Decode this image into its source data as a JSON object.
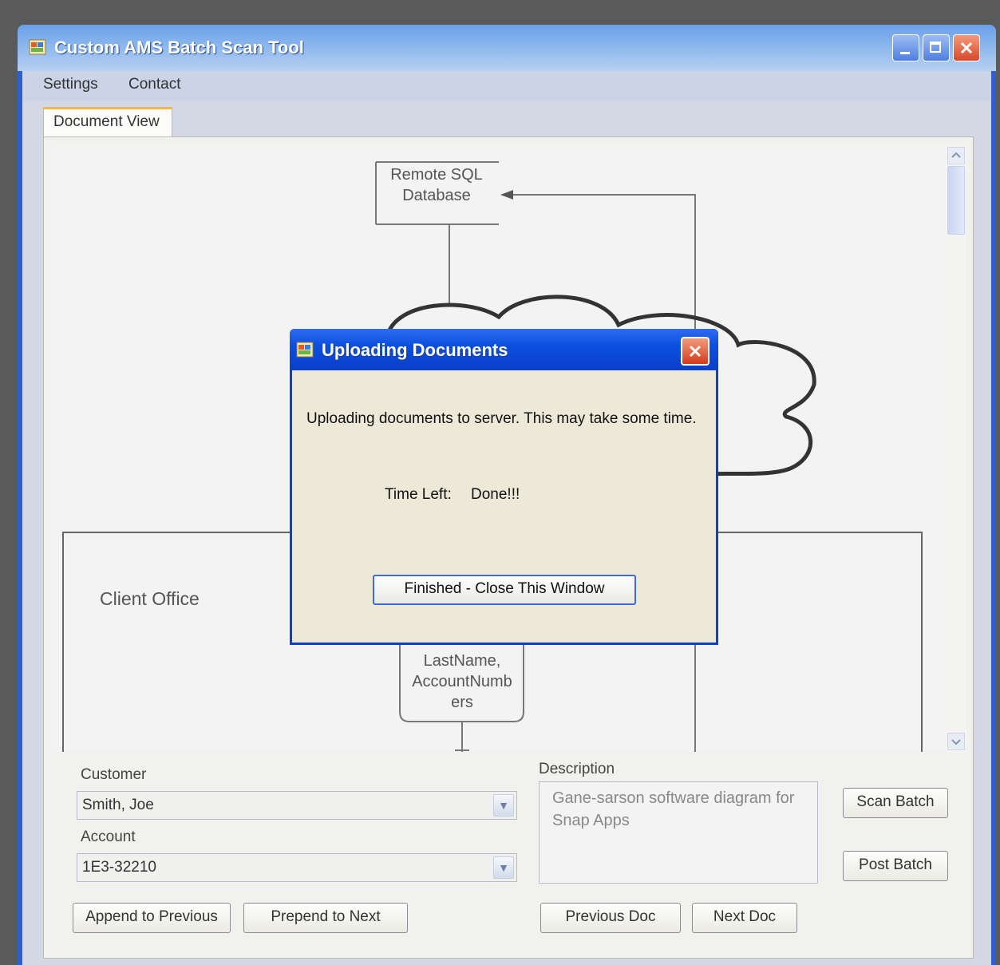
{
  "window": {
    "title": "Custom AMS Batch Scan Tool"
  },
  "menu": {
    "items": [
      "Settings",
      "Contact"
    ]
  },
  "tabs": [
    {
      "label": "Document View",
      "active": true
    }
  ],
  "diagram": {
    "remote_db": [
      "Remote SQL",
      "Database"
    ],
    "client_office": "Client Office",
    "store_box": [
      "LastName,",
      "AccountNumb",
      "ers"
    ]
  },
  "form": {
    "customer_label": "Customer",
    "customer_value": "Smith, Joe",
    "account_label": "Account",
    "account_value": "1E3-32210",
    "description_label": "Description",
    "description_text": "Gane-sarson software diagram for Snap Apps",
    "buttons": {
      "append_previous": "Append to Previous",
      "prepend_next": "Prepend to Next",
      "previous_doc": "Previous Doc",
      "next_doc": "Next Doc",
      "scan_batch": "Scan Batch",
      "post_batch": "Post Batch"
    }
  },
  "dialog": {
    "title": "Uploading Documents",
    "message": "Uploading documents to server. This may take some time.",
    "time_left_label": "Time Left:",
    "time_left_value": "Done!!!",
    "finish_button": "Finished - Close This Window"
  },
  "colors": {
    "xp_blue": "#0a3ed6",
    "dialog_face": "#ece9d8",
    "close_red": "#d9482a"
  }
}
